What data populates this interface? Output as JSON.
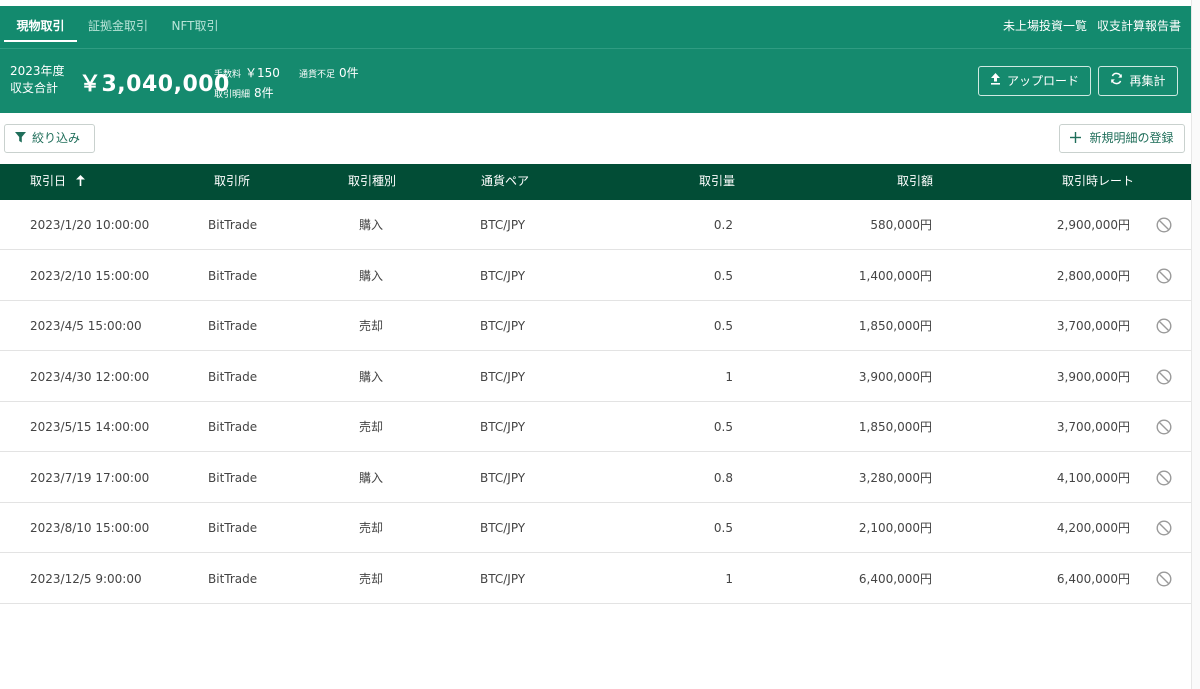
{
  "tabs": [
    {
      "label": "現物取引",
      "active": true
    },
    {
      "label": "証拠金取引",
      "active": false
    },
    {
      "label": "NFT取引",
      "active": false
    }
  ],
  "top_links": {
    "unlisted": "未上場投資一覧",
    "report": "収支計算報告書"
  },
  "summary": {
    "year_label": "2023年度",
    "total_label": "収支合計",
    "total_value": "￥3,040,000",
    "fee_label": "手数料",
    "fee_value": "￥150",
    "shortage_label": "通貨不足",
    "shortage_value": "0件",
    "detail_label": "取引明細",
    "detail_value": "8件"
  },
  "buttons": {
    "upload": "アップロード",
    "recalc": "再集計",
    "filter": "絞り込み",
    "add": "新規明細の登録"
  },
  "icons": {
    "upload": "upload-icon",
    "recalc": "refresh-icon",
    "filter": "filter-icon",
    "add": "plus-icon",
    "sort": "arrow-up-icon",
    "cancel": "cancel-icon"
  },
  "colors": {
    "primary": "#138a6e",
    "header_dark": "#024d36"
  },
  "table": {
    "columns": {
      "date": "取引日",
      "exchange": "取引所",
      "type": "取引種別",
      "pair": "通貨ペア",
      "qty": "取引量",
      "amount": "取引額",
      "rate": "取引時レート"
    },
    "rows": [
      {
        "date": "2023/1/20 10:00:00",
        "exchange": "BitTrade",
        "type": "購入",
        "pair": "BTC/JPY",
        "qty": "0.2",
        "amount": "580,000円",
        "rate": "2,900,000円"
      },
      {
        "date": "2023/2/10 15:00:00",
        "exchange": "BitTrade",
        "type": "購入",
        "pair": "BTC/JPY",
        "qty": "0.5",
        "amount": "1,400,000円",
        "rate": "2,800,000円"
      },
      {
        "date": "2023/4/5 15:00:00",
        "exchange": "BitTrade",
        "type": "売却",
        "pair": "BTC/JPY",
        "qty": "0.5",
        "amount": "1,850,000円",
        "rate": "3,700,000円"
      },
      {
        "date": "2023/4/30 12:00:00",
        "exchange": "BitTrade",
        "type": "購入",
        "pair": "BTC/JPY",
        "qty": "1",
        "amount": "3,900,000円",
        "rate": "3,900,000円"
      },
      {
        "date": "2023/5/15 14:00:00",
        "exchange": "BitTrade",
        "type": "売却",
        "pair": "BTC/JPY",
        "qty": "0.5",
        "amount": "1,850,000円",
        "rate": "3,700,000円"
      },
      {
        "date": "2023/7/19 17:00:00",
        "exchange": "BitTrade",
        "type": "購入",
        "pair": "BTC/JPY",
        "qty": "0.8",
        "amount": "3,280,000円",
        "rate": "4,100,000円"
      },
      {
        "date": "2023/8/10 15:00:00",
        "exchange": "BitTrade",
        "type": "売却",
        "pair": "BTC/JPY",
        "qty": "0.5",
        "amount": "2,100,000円",
        "rate": "4,200,000円"
      },
      {
        "date": "2023/12/5 9:00:00",
        "exchange": "BitTrade",
        "type": "売却",
        "pair": "BTC/JPY",
        "qty": "1",
        "amount": "6,400,000円",
        "rate": "6,400,000円"
      }
    ]
  }
}
